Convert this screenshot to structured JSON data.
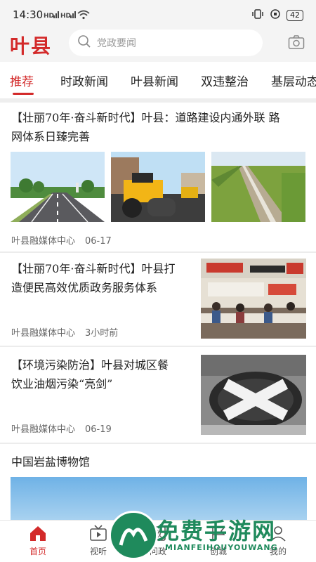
{
  "status_bar": {
    "time": "14:30",
    "signal1": "HD",
    "signal2": "HD",
    "battery": "42"
  },
  "header": {
    "logo": "叶县",
    "search_placeholder": "党政要闻"
  },
  "tabs": [
    {
      "label": "推荐"
    },
    {
      "label": "时政新闻"
    },
    {
      "label": "叶县新闻"
    },
    {
      "label": "双违整治"
    },
    {
      "label": "基层动态"
    }
  ],
  "articles": [
    {
      "title_line1": "【壮丽70年·奋斗新时代】叶县：道路建设内通外联 路",
      "title_line2": "网体系日臻完善",
      "source": "叶县融媒体中心",
      "date": "06-17"
    },
    {
      "title_line1": "【壮丽70年·奋斗新时代】叶县打",
      "title_line2": "造便民高效优质政务服务体系",
      "source": "叶县融媒体中心",
      "date": "3小时前"
    },
    {
      "title_line1": "【环境污染防治】叶县对城区餐",
      "title_line2": "饮业油烟污染“亮剑”",
      "source": "叶县融媒体中心",
      "date": "06-19"
    },
    {
      "title_line1": "中国岩盐博物馆"
    }
  ],
  "bottom_nav": [
    {
      "label": "首页"
    },
    {
      "label": "视听"
    },
    {
      "label": "问政"
    },
    {
      "label": "创城"
    },
    {
      "label": "我的"
    }
  ],
  "watermark": {
    "main": "免费手游网",
    "sub": "MIANFEIHOUYOUWANG"
  },
  "colors": {
    "accent": "#d32a2a",
    "watermark": "#1f8a5c"
  }
}
